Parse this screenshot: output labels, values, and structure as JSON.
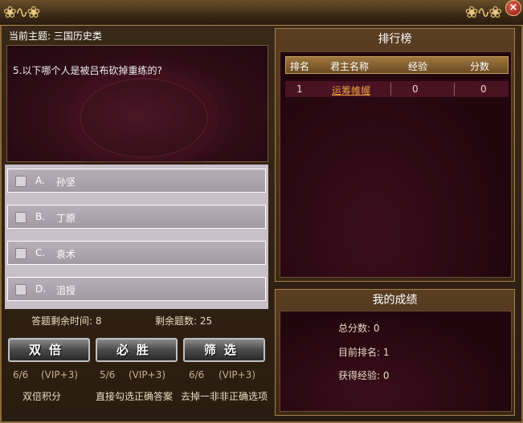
{
  "window": {
    "close_icon": "×"
  },
  "topic": {
    "label": "当前主题: 三国历史类"
  },
  "question": {
    "text": "5.以下哪个人是被吕布砍掉重练的?"
  },
  "options": [
    {
      "letter": "A.",
      "text": "孙坚"
    },
    {
      "letter": "B.",
      "text": "丁原"
    },
    {
      "letter": "C.",
      "text": "袁术"
    },
    {
      "letter": "D.",
      "text": "沮授"
    }
  ],
  "status": {
    "time_label": "答题剩余时间:  8",
    "remain_label": "剩余题数: 25"
  },
  "skills": [
    {
      "label": "双倍",
      "count": "6/6",
      "vip": "(VIP+3)",
      "desc": "双倍积分"
    },
    {
      "label": "必胜",
      "count": "5/6",
      "vip": "(VIP+3)",
      "desc": "直接勾选正确答案"
    },
    {
      "label": "筛选",
      "count": "6/6",
      "vip": "(VIP+3)",
      "desc": "去掉一非非正确选项"
    }
  ],
  "leaderboard": {
    "title": "排行榜",
    "headers": [
      "排名",
      "君主名称",
      "经验",
      "分数"
    ],
    "rows": [
      {
        "rank": "1",
        "name": "运筹帷幄",
        "exp": "0",
        "score": "0"
      }
    ]
  },
  "my_result": {
    "title": "我的成绩",
    "total_score": "总分数:   0",
    "current_rank": "目前排名:   1",
    "exp_gained": "获得经验:   0"
  },
  "colors": {
    "accent": "#e8a040",
    "panel": "#3a0e1c",
    "frame": "#a88050"
  }
}
